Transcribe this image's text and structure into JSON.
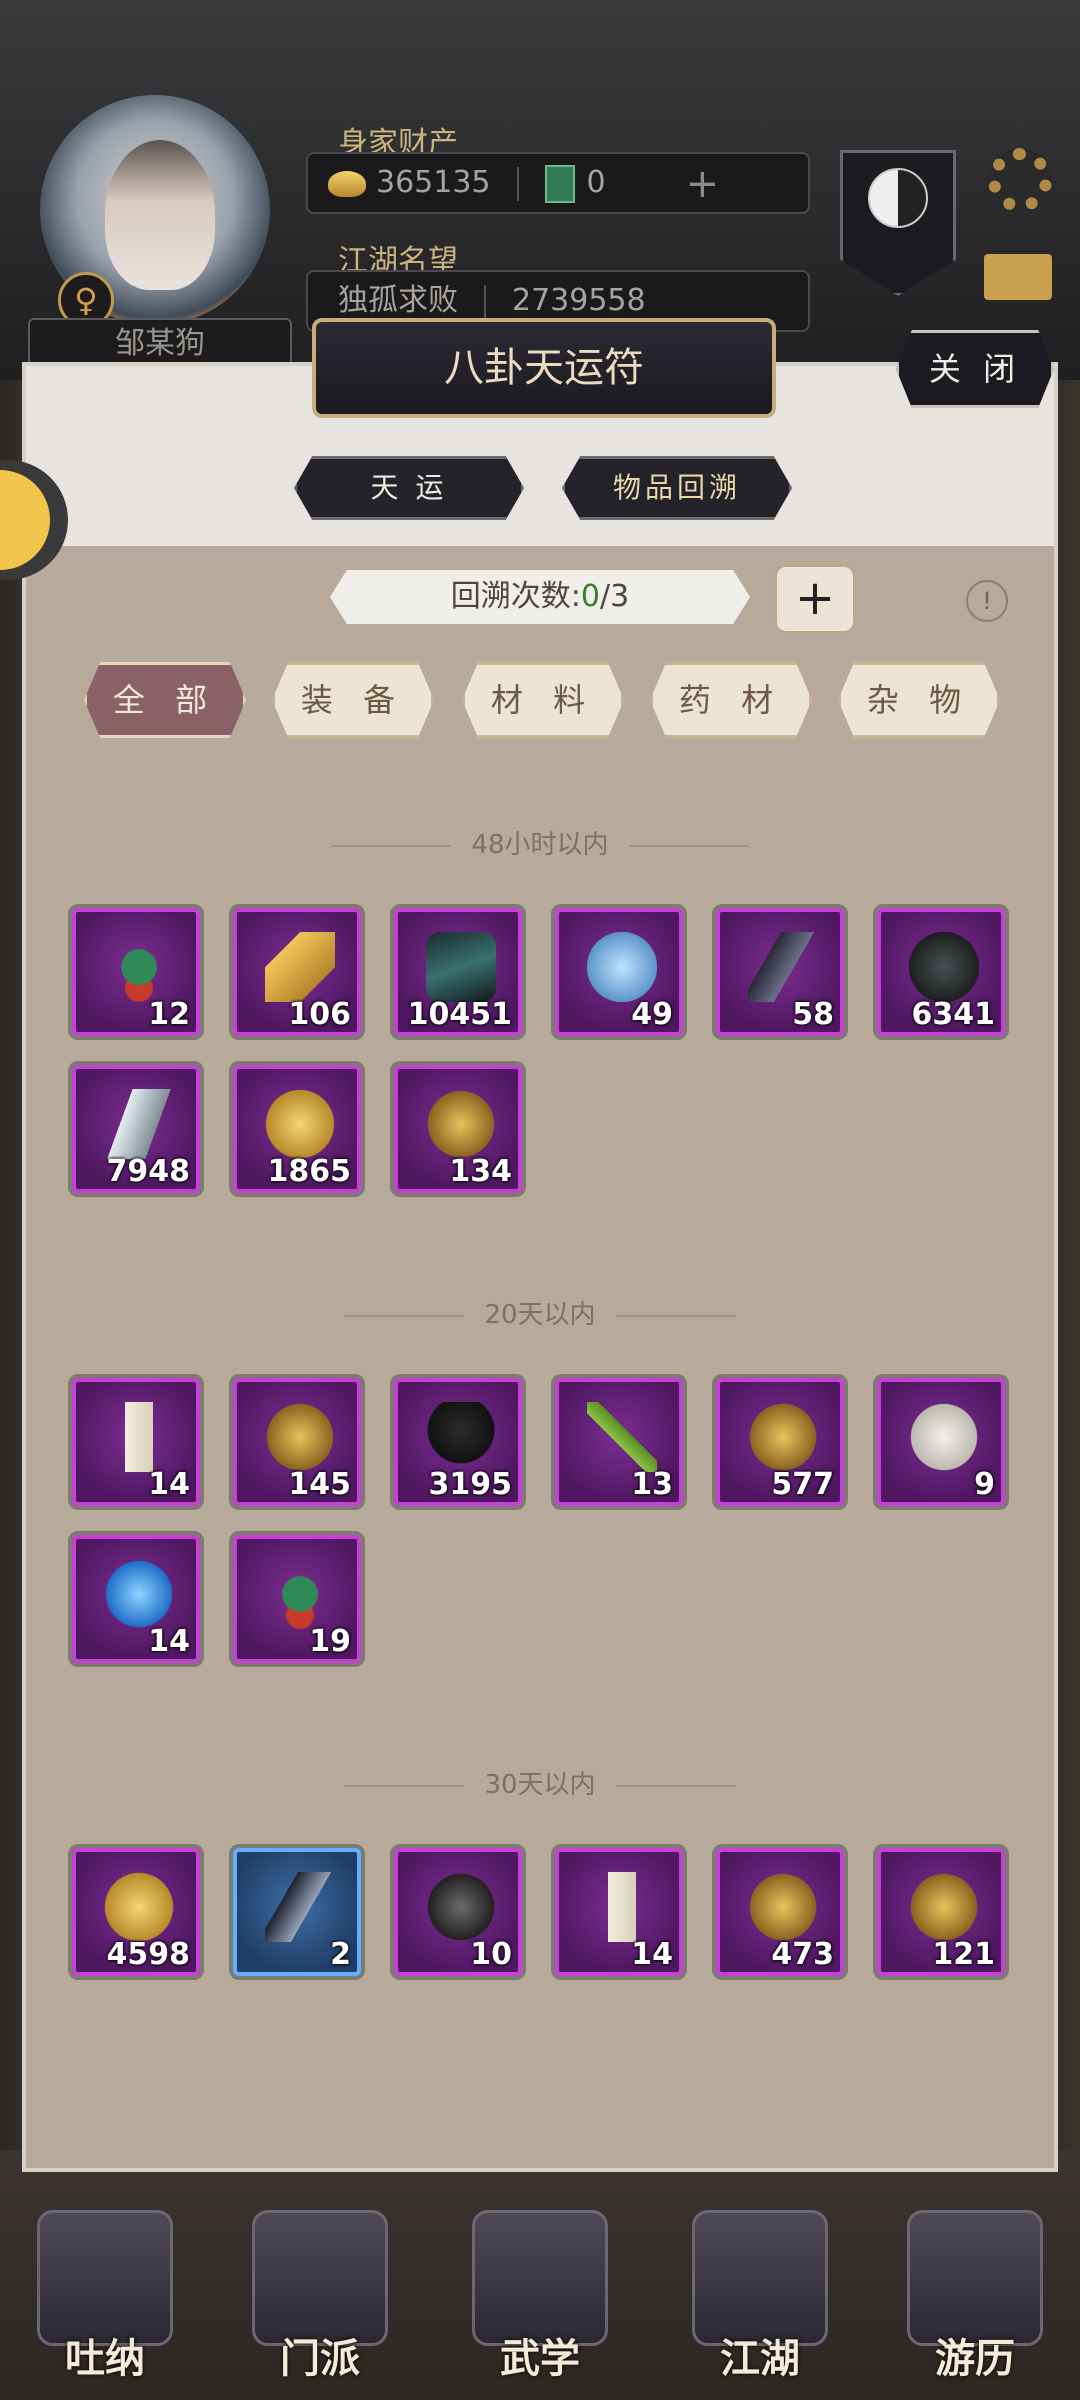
{
  "header": {
    "player_name": "邹某狗",
    "gender_symbol": "♀",
    "wealth_label": "身家财产",
    "gold": "365135",
    "jade": "0",
    "fame_label": "江湖名望",
    "fame_title": "独孤求败",
    "fame_value": "2739558"
  },
  "dialog": {
    "title": "八卦天运符",
    "close_label": "关 闭",
    "tabs": [
      "天 运",
      "物品回溯"
    ],
    "count_label": "回溯次数:",
    "count_used": "0",
    "count_total": "/3",
    "plus_label": "+",
    "info_label": "!",
    "categories": [
      "全 部",
      "装 备",
      "材 料",
      "药 材",
      "杂 物"
    ]
  },
  "sections": [
    {
      "title": "48小时以内",
      "items": [
        {
          "icon": "jade-pendant-icon",
          "qty": "12"
        },
        {
          "icon": "gold-shard-icon",
          "qty": "106"
        },
        {
          "icon": "dark-ore-icon",
          "qty": "10451"
        },
        {
          "icon": "blue-crystal-ore-icon",
          "qty": "49"
        },
        {
          "icon": "black-crystal-icon",
          "qty": "58"
        },
        {
          "icon": "black-stone-icon",
          "qty": "6341"
        },
        {
          "icon": "silver-crystal-icon",
          "qty": "7948"
        },
        {
          "icon": "gold-ingot-icon",
          "qty": "1865"
        },
        {
          "icon": "gold-nugget-icon",
          "qty": "134"
        }
      ]
    },
    {
      "title": "20天以内",
      "items": [
        {
          "icon": "scroll-icon",
          "qty": "14"
        },
        {
          "icon": "gold-nugget-icon",
          "qty": "145"
        },
        {
          "icon": "helmet-icon",
          "qty": "3195"
        },
        {
          "icon": "bamboo-icon",
          "qty": "13"
        },
        {
          "icon": "gold-nugget-icon",
          "qty": "577"
        },
        {
          "icon": "white-mask-icon",
          "qty": "9"
        },
        {
          "icon": "blue-gem-icon",
          "qty": "14"
        },
        {
          "icon": "jade-pendant-icon",
          "qty": "19"
        }
      ]
    },
    {
      "title": "30天以内",
      "items": [
        {
          "icon": "gold-ingot-icon",
          "qty": "4598"
        },
        {
          "icon": "dark-crystal-icon",
          "qty": "2",
          "quality": "blue"
        },
        {
          "icon": "carved-stone-icon",
          "qty": "10"
        },
        {
          "icon": "scroll-icon",
          "qty": "14"
        },
        {
          "icon": "gold-nugget-icon",
          "qty": "473"
        },
        {
          "icon": "gold-nugget-icon",
          "qty": "121"
        }
      ]
    }
  ],
  "nav": [
    "吐纳",
    "门派",
    "武学",
    "江湖",
    "游历"
  ],
  "colors": {
    "purple_frame": "#c640d8",
    "blue_frame": "#5fb0ff",
    "gold_text": "#e8d7a8"
  }
}
